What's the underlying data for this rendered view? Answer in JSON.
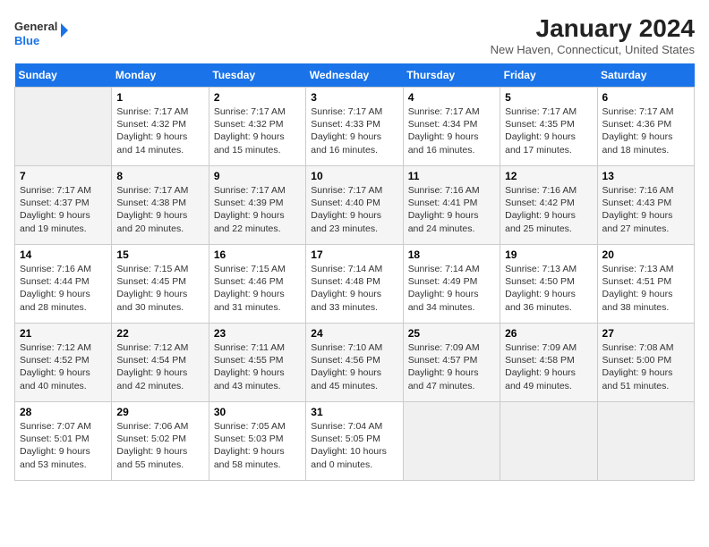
{
  "header": {
    "logo_line1": "General",
    "logo_line2": "Blue",
    "month_title": "January 2024",
    "subtitle": "New Haven, Connecticut, United States"
  },
  "days_of_week": [
    "Sunday",
    "Monday",
    "Tuesday",
    "Wednesday",
    "Thursday",
    "Friday",
    "Saturday"
  ],
  "weeks": [
    [
      {
        "day": "",
        "info": ""
      },
      {
        "day": "1",
        "info": "Sunrise: 7:17 AM\nSunset: 4:32 PM\nDaylight: 9 hours\nand 14 minutes."
      },
      {
        "day": "2",
        "info": "Sunrise: 7:17 AM\nSunset: 4:32 PM\nDaylight: 9 hours\nand 15 minutes."
      },
      {
        "day": "3",
        "info": "Sunrise: 7:17 AM\nSunset: 4:33 PM\nDaylight: 9 hours\nand 16 minutes."
      },
      {
        "day": "4",
        "info": "Sunrise: 7:17 AM\nSunset: 4:34 PM\nDaylight: 9 hours\nand 16 minutes."
      },
      {
        "day": "5",
        "info": "Sunrise: 7:17 AM\nSunset: 4:35 PM\nDaylight: 9 hours\nand 17 minutes."
      },
      {
        "day": "6",
        "info": "Sunrise: 7:17 AM\nSunset: 4:36 PM\nDaylight: 9 hours\nand 18 minutes."
      }
    ],
    [
      {
        "day": "7",
        "info": "Sunrise: 7:17 AM\nSunset: 4:37 PM\nDaylight: 9 hours\nand 19 minutes."
      },
      {
        "day": "8",
        "info": "Sunrise: 7:17 AM\nSunset: 4:38 PM\nDaylight: 9 hours\nand 20 minutes."
      },
      {
        "day": "9",
        "info": "Sunrise: 7:17 AM\nSunset: 4:39 PM\nDaylight: 9 hours\nand 22 minutes."
      },
      {
        "day": "10",
        "info": "Sunrise: 7:17 AM\nSunset: 4:40 PM\nDaylight: 9 hours\nand 23 minutes."
      },
      {
        "day": "11",
        "info": "Sunrise: 7:16 AM\nSunset: 4:41 PM\nDaylight: 9 hours\nand 24 minutes."
      },
      {
        "day": "12",
        "info": "Sunrise: 7:16 AM\nSunset: 4:42 PM\nDaylight: 9 hours\nand 25 minutes."
      },
      {
        "day": "13",
        "info": "Sunrise: 7:16 AM\nSunset: 4:43 PM\nDaylight: 9 hours\nand 27 minutes."
      }
    ],
    [
      {
        "day": "14",
        "info": "Sunrise: 7:16 AM\nSunset: 4:44 PM\nDaylight: 9 hours\nand 28 minutes."
      },
      {
        "day": "15",
        "info": "Sunrise: 7:15 AM\nSunset: 4:45 PM\nDaylight: 9 hours\nand 30 minutes."
      },
      {
        "day": "16",
        "info": "Sunrise: 7:15 AM\nSunset: 4:46 PM\nDaylight: 9 hours\nand 31 minutes."
      },
      {
        "day": "17",
        "info": "Sunrise: 7:14 AM\nSunset: 4:48 PM\nDaylight: 9 hours\nand 33 minutes."
      },
      {
        "day": "18",
        "info": "Sunrise: 7:14 AM\nSunset: 4:49 PM\nDaylight: 9 hours\nand 34 minutes."
      },
      {
        "day": "19",
        "info": "Sunrise: 7:13 AM\nSunset: 4:50 PM\nDaylight: 9 hours\nand 36 minutes."
      },
      {
        "day": "20",
        "info": "Sunrise: 7:13 AM\nSunset: 4:51 PM\nDaylight: 9 hours\nand 38 minutes."
      }
    ],
    [
      {
        "day": "21",
        "info": "Sunrise: 7:12 AM\nSunset: 4:52 PM\nDaylight: 9 hours\nand 40 minutes."
      },
      {
        "day": "22",
        "info": "Sunrise: 7:12 AM\nSunset: 4:54 PM\nDaylight: 9 hours\nand 42 minutes."
      },
      {
        "day": "23",
        "info": "Sunrise: 7:11 AM\nSunset: 4:55 PM\nDaylight: 9 hours\nand 43 minutes."
      },
      {
        "day": "24",
        "info": "Sunrise: 7:10 AM\nSunset: 4:56 PM\nDaylight: 9 hours\nand 45 minutes."
      },
      {
        "day": "25",
        "info": "Sunrise: 7:09 AM\nSunset: 4:57 PM\nDaylight: 9 hours\nand 47 minutes."
      },
      {
        "day": "26",
        "info": "Sunrise: 7:09 AM\nSunset: 4:58 PM\nDaylight: 9 hours\nand 49 minutes."
      },
      {
        "day": "27",
        "info": "Sunrise: 7:08 AM\nSunset: 5:00 PM\nDaylight: 9 hours\nand 51 minutes."
      }
    ],
    [
      {
        "day": "28",
        "info": "Sunrise: 7:07 AM\nSunset: 5:01 PM\nDaylight: 9 hours\nand 53 minutes."
      },
      {
        "day": "29",
        "info": "Sunrise: 7:06 AM\nSunset: 5:02 PM\nDaylight: 9 hours\nand 55 minutes."
      },
      {
        "day": "30",
        "info": "Sunrise: 7:05 AM\nSunset: 5:03 PM\nDaylight: 9 hours\nand 58 minutes."
      },
      {
        "day": "31",
        "info": "Sunrise: 7:04 AM\nSunset: 5:05 PM\nDaylight: 10 hours\nand 0 minutes."
      },
      {
        "day": "",
        "info": ""
      },
      {
        "day": "",
        "info": ""
      },
      {
        "day": "",
        "info": ""
      }
    ]
  ]
}
